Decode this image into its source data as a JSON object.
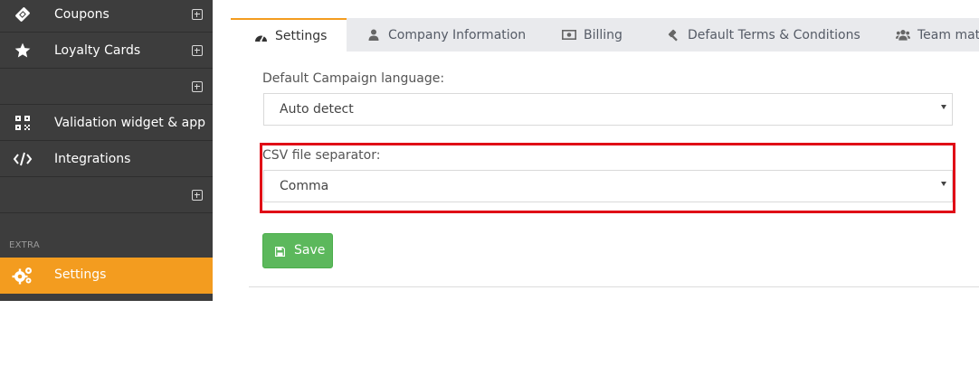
{
  "sidebar": {
    "items": [
      {
        "label": "Coupons",
        "icon": "ticket-icon",
        "expandable": true
      },
      {
        "label": "Loyalty Cards",
        "icon": "star-icon",
        "expandable": true
      },
      {
        "label": "",
        "icon": "",
        "expandable": true
      },
      {
        "label": "Validation widget & app",
        "icon": "qrcode-icon",
        "expandable": false
      },
      {
        "label": "Integrations",
        "icon": "code-icon",
        "expandable": false
      },
      {
        "label": "",
        "icon": "",
        "expandable": true
      }
    ],
    "section_label": "EXTRA",
    "active_item": {
      "label": "Settings",
      "icon": "cogs-icon"
    },
    "colors": {
      "background": "#3d3d3d",
      "active": "#f39c1f"
    }
  },
  "tabs": [
    {
      "label": "Settings",
      "icon": "dashboard-icon",
      "active": true
    },
    {
      "label": "Company Information",
      "icon": "user-icon",
      "active": false
    },
    {
      "label": "Billing",
      "icon": "money-icon",
      "active": false
    },
    {
      "label": "Default Terms & Conditions",
      "icon": "gavel-icon",
      "active": false
    },
    {
      "label": "Team mat",
      "icon": "users-icon",
      "active": false
    }
  ],
  "form": {
    "campaign_language_label": "Default Campaign language:",
    "campaign_language_value": "Auto detect",
    "csv_separator_label": "CSV file separator:",
    "csv_separator_value": "Comma",
    "save_label": "Save"
  },
  "colors": {
    "highlight": "#e00a16",
    "save_button": "#5cb85c",
    "tab_accent": "#f39c1f"
  }
}
